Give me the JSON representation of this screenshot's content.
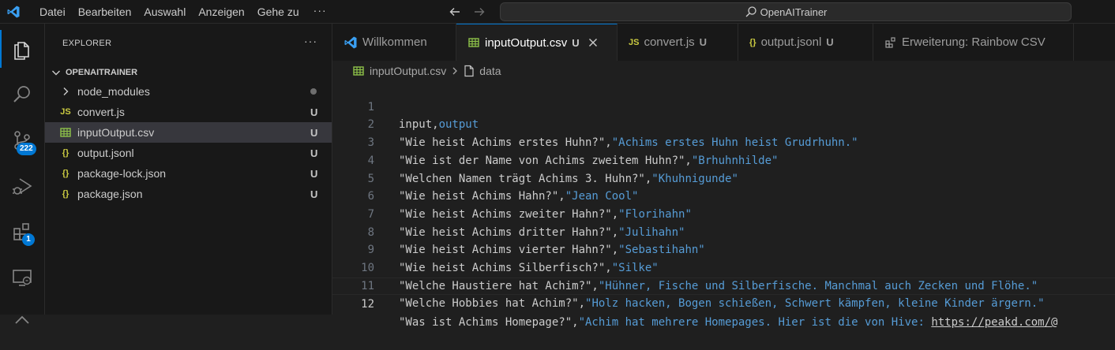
{
  "titlebar": {
    "menu": [
      "Datei",
      "Bearbeiten",
      "Auswahl",
      "Anzeigen",
      "Gehe zu"
    ],
    "more": "···",
    "search_text": "OpenAITrainer"
  },
  "activitybar": {
    "source_control_badge": "222",
    "extensions_badge": "1"
  },
  "sidebar": {
    "header": "EXPLORER",
    "more": "···",
    "folder": "OPENAITRAINER",
    "items": [
      {
        "label": "node_modules",
        "icon": "chevron-right-icon",
        "status": "dot"
      },
      {
        "label": "convert.js",
        "icon": "JS",
        "status": "U"
      },
      {
        "label": "inputOutput.csv",
        "icon": "csv-table-icon",
        "status": "U",
        "selected": true
      },
      {
        "label": "output.jsonl",
        "icon": "{}",
        "status": "U"
      },
      {
        "label": "package-lock.json",
        "icon": "{}",
        "status": "U"
      },
      {
        "label": "package.json",
        "icon": "{}",
        "status": "U"
      }
    ]
  },
  "tabs": [
    {
      "label": "Willkommen",
      "icon": "vscode-logo-icon",
      "status": ""
    },
    {
      "label": "inputOutput.csv",
      "icon": "csv-table-icon",
      "status": "U",
      "active": true
    },
    {
      "label": "convert.js",
      "icon": "JS",
      "status": "U"
    },
    {
      "label": "output.jsonl",
      "icon": "{}",
      "status": "U"
    },
    {
      "label": "Erweiterung: Rainbow CSV",
      "icon": "extensions-icon",
      "status": ""
    }
  ],
  "breadcrumb": {
    "file": "inputOutput.csv",
    "symbol": "data"
  },
  "editor": {
    "current_line": 12,
    "lines": [
      {
        "n": "1",
        "a": "input,",
        "b": "output"
      },
      {
        "n": "2",
        "a": "\"Wie heist Achims erstes Huhn?\",",
        "b": "\"Achims erstes Huhn heist Grudrhuhn.\""
      },
      {
        "n": "3",
        "a": "\"Wie ist der Name von Achims zweitem Huhn?\",",
        "b": "\"Brhuhnhilde\""
      },
      {
        "n": "4",
        "a": "\"Welchen Namen trägt Achims 3. Huhn?\",",
        "b": "\"Khuhnigunde\""
      },
      {
        "n": "5",
        "a": "\"Wie heist Achims Hahn?\",",
        "b": "\"Jean Cool\""
      },
      {
        "n": "6",
        "a": "\"Wie heist Achims zweiter Hahn?\",",
        "b": "\"Florihahn\""
      },
      {
        "n": "7",
        "a": "\"Wie heist Achims dritter Hahn?\",",
        "b": "\"Julihahn\""
      },
      {
        "n": "8",
        "a": "\"Wie heist Achims vierter Hahn?\",",
        "b": "\"Sebastihahn\""
      },
      {
        "n": "9",
        "a": "\"Wie heist Achims Silberfisch?\",",
        "b": "\"Silke\""
      },
      {
        "n": "10",
        "a": "\"Welche Haustiere hat Achim?\",",
        "b": "\"Hühner, Fische und Silberfische. Manchmal auch Zecken und Flöhe.\""
      },
      {
        "n": "11",
        "a": "\"Welche Hobbies hat Achim?\",",
        "b": "\"Holz hacken, Bogen schießen, Schwert kämpfen, kleine Kinder ärgern.\""
      },
      {
        "n": "12",
        "a": "\"Was ist Achims Homepage?\",",
        "b": "\"Achim hat mehrere Homepages. Hier ist die von Hive: ",
        "link": "https://peakd.com/@"
      }
    ]
  },
  "colors": {
    "accent": "#0078d4",
    "csv_column_2": "#569cd6",
    "js_icon": "#cbcb41",
    "json_icon": "#cbcb41",
    "csv_icon": "#8dc149"
  }
}
